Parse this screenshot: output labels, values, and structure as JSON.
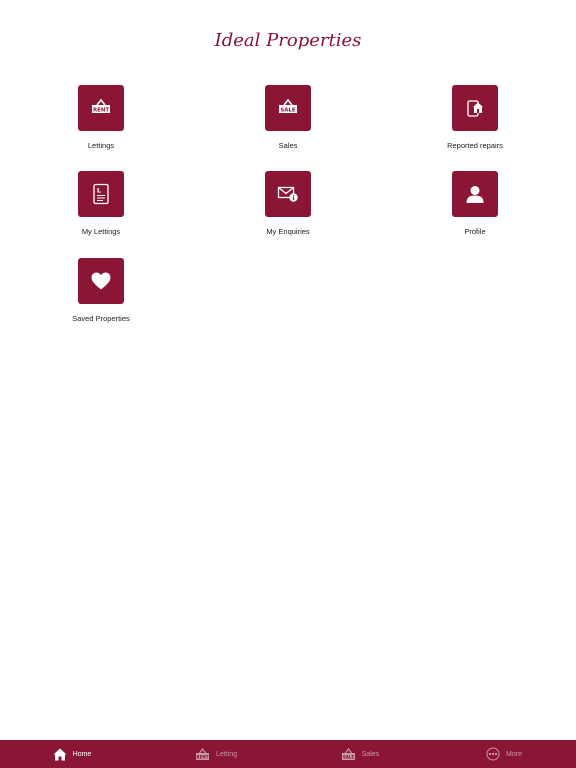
{
  "header": {
    "title": "Ideal Properties"
  },
  "tiles": [
    {
      "label": "Lettings",
      "icon": "rent-sign-icon"
    },
    {
      "label": "Sales",
      "icon": "sale-sign-icon"
    },
    {
      "label": "Reported repairs",
      "icon": "house-repair-icon"
    },
    {
      "label": "My Lettings",
      "icon": "letting-document-icon"
    },
    {
      "label": "My Enquiries",
      "icon": "mail-info-icon"
    },
    {
      "label": "Profile",
      "icon": "user-icon"
    },
    {
      "label": "Saved Properties",
      "icon": "heart-icon"
    }
  ],
  "sign_text": {
    "rent": "RENT",
    "sale": "SALE",
    "doc_letter": "L"
  },
  "bottom_nav": {
    "items": [
      {
        "label": "Home",
        "icon": "home-icon",
        "active": true
      },
      {
        "label": "Letting",
        "icon": "rent-sign-icon",
        "active": false
      },
      {
        "label": "Sales",
        "icon": "sale-sign-icon",
        "active": false
      },
      {
        "label": "More",
        "icon": "more-icon",
        "active": false
      }
    ]
  },
  "colors": {
    "brand": "#8b1535",
    "background": "#ffffff",
    "text": "#222222"
  }
}
